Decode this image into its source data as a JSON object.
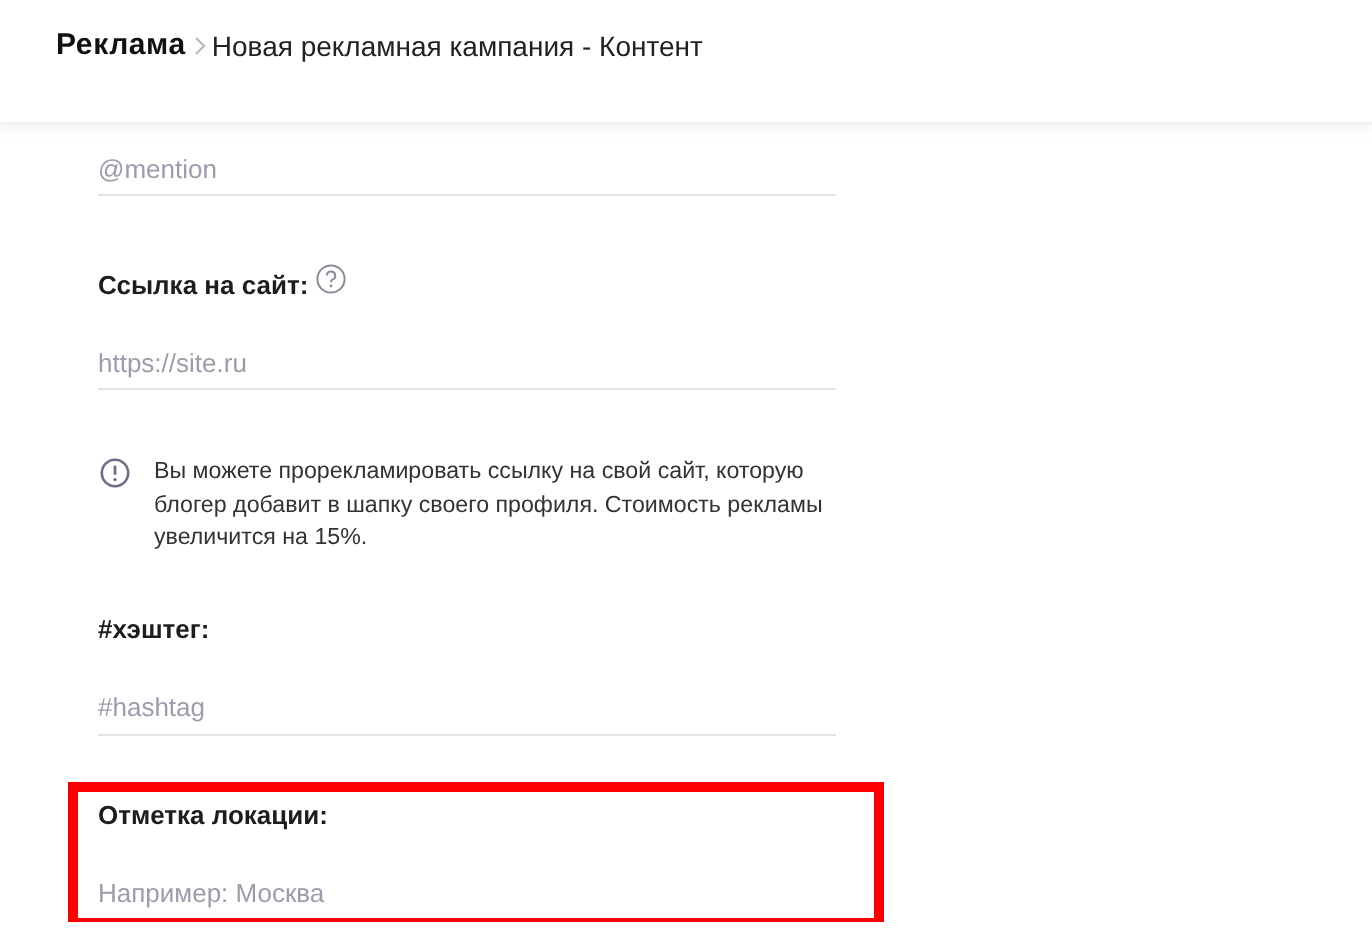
{
  "breadcrumb": {
    "section": "Реклама",
    "page": "Новая рекламная кампания - Контент"
  },
  "items": [
    {
      "kind": "input",
      "placeholder": "@mention"
    },
    {
      "kind": "input",
      "label": "Ссылка на сайт:",
      "placeholder": "https://site.ru",
      "help": true
    },
    {
      "kind": "note",
      "text": "Вы можете прорекламировать ссылку на свой сайт, которую блогер добавит в шапку своего профиля. Стоимость рекламы увеличится на 15%."
    },
    {
      "kind": "input",
      "label": "#хэштег:",
      "placeholder": "#hashtag"
    },
    {
      "kind": "input",
      "label": "Отметка локации:",
      "placeholder": "Например: Москва",
      "highlighted": true
    }
  ]
}
